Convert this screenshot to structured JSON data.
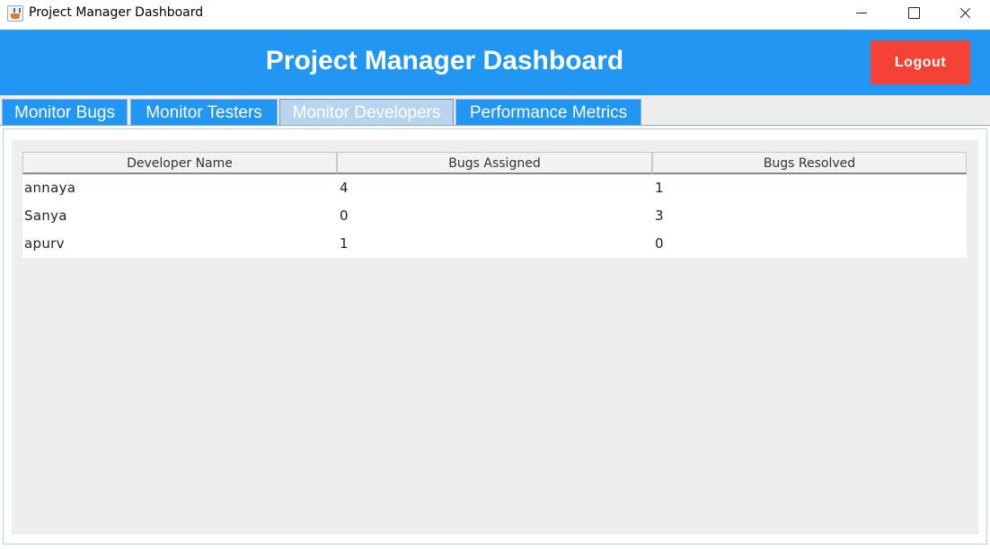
{
  "window": {
    "title": "Project Manager Dashboard",
    "icon": "java-cup-icon"
  },
  "header": {
    "title": "Project Manager Dashboard",
    "logout_label": "Logout",
    "bg_color": "#2196f3",
    "logout_color": "#f44336"
  },
  "tabs": [
    {
      "label": "Monitor Bugs",
      "selected": false
    },
    {
      "label": "Monitor Testers",
      "selected": false
    },
    {
      "label": "Monitor Developers",
      "selected": true
    },
    {
      "label": "Performance Metrics",
      "selected": false
    }
  ],
  "table": {
    "columns": [
      "Developer Name",
      "Bugs Assigned",
      "Bugs Resolved"
    ],
    "rows": [
      [
        "annaya",
        "4",
        "1"
      ],
      [
        "Sanya",
        "0",
        "3"
      ],
      [
        "apurv",
        "1",
        "0"
      ]
    ]
  }
}
